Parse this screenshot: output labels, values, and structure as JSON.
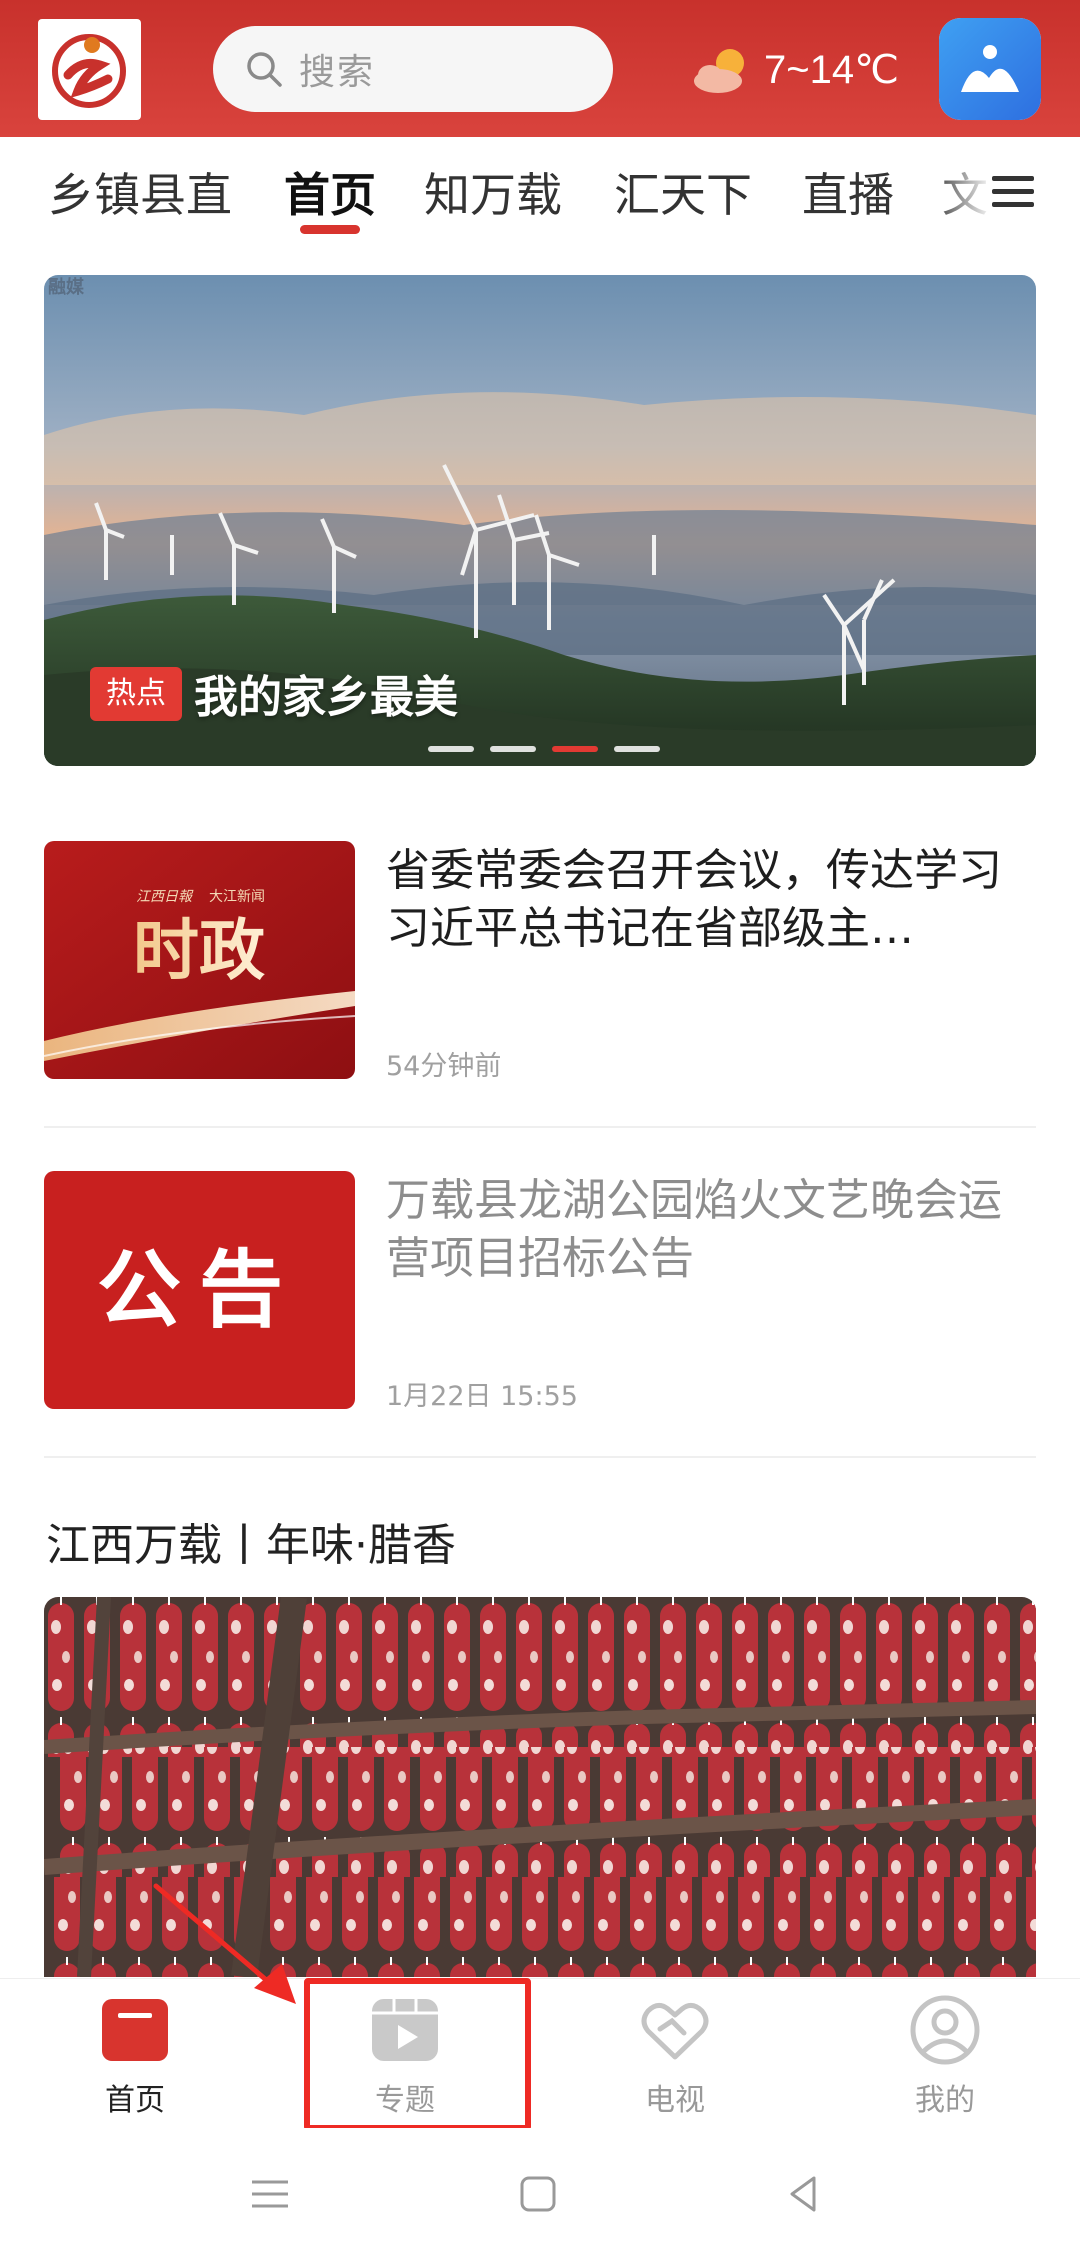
{
  "header": {
    "search_placeholder": "搜索",
    "weather": {
      "temperature": "7~14℃",
      "icon": "partly-cloudy-icon"
    },
    "colors": {
      "brand": "#d1382f"
    }
  },
  "tabs": [
    {
      "label": "乡镇县直",
      "active": false
    },
    {
      "label": "首页",
      "active": true
    },
    {
      "label": "知万载",
      "active": false
    },
    {
      "label": "汇天下",
      "active": false
    },
    {
      "label": "直播",
      "active": false
    },
    {
      "label": "文",
      "active": false
    }
  ],
  "banner": {
    "watermark": "融媒",
    "tag": "热点",
    "title": "我的家乡最美",
    "slide_count": 4,
    "active_slide": 3
  },
  "news": [
    {
      "thumb_brand_left": "江西日報",
      "thumb_brand_right": "大江新闻",
      "thumb_text": "时政",
      "title": "省委常委会召开会议，传达学习习近平总书记在省部级主…",
      "time": "54分钟前",
      "read": false
    },
    {
      "thumb_text": "公告",
      "title": "万载县龙湖公园焰火文艺晚会运营项目招标公告",
      "time": "1月22日 15:55",
      "read": true
    }
  ],
  "section": {
    "title": "江西万载丨年味·腊香"
  },
  "bottom_nav": [
    {
      "label": "首页",
      "icon": "home-icon",
      "active": true
    },
    {
      "label": "专题",
      "icon": "topic-play-icon",
      "active": false
    },
    {
      "label": "电视",
      "icon": "tv-heart-icon",
      "active": false
    },
    {
      "label": "我的",
      "icon": "profile-icon",
      "active": false
    }
  ]
}
